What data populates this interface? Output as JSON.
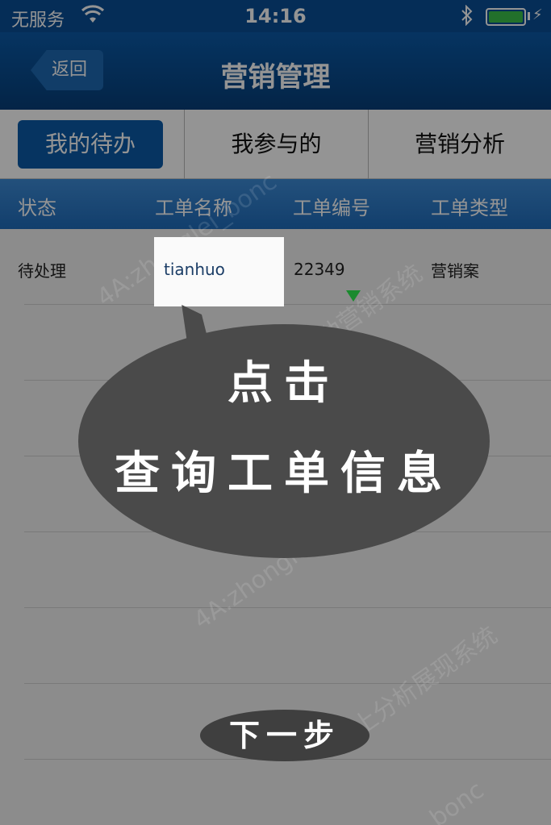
{
  "status_bar": {
    "carrier": "无服务",
    "time": "14:16"
  },
  "nav": {
    "back_label": "返回",
    "title": "营销管理"
  },
  "tabs": [
    {
      "label": "我的待办",
      "active": true
    },
    {
      "label": "我参与的",
      "active": false
    },
    {
      "label": "营销分析",
      "active": false
    }
  ],
  "table": {
    "headers": [
      "状态",
      "工单名称",
      "工单编号",
      "工单类型"
    ],
    "rows": [
      {
        "status": "待处理",
        "name": "tianhuo",
        "number": "22349",
        "type": "营销案"
      }
    ]
  },
  "guide": {
    "line1": "点击",
    "line2": "查询工单信息",
    "next_label": "下一步"
  },
  "watermark_texts": [
    "4A:zhonglei_bonc",
    "湖北移动营销系统",
    "4A:zhonglei_bonc",
    "上分析展现系统",
    "bonc"
  ],
  "colors": {
    "brand_blue": "#0b5aa8",
    "header_blue": "#2a78c6",
    "arrow_green": "#1a8a2e",
    "bubble": "#4a4a4a"
  }
}
